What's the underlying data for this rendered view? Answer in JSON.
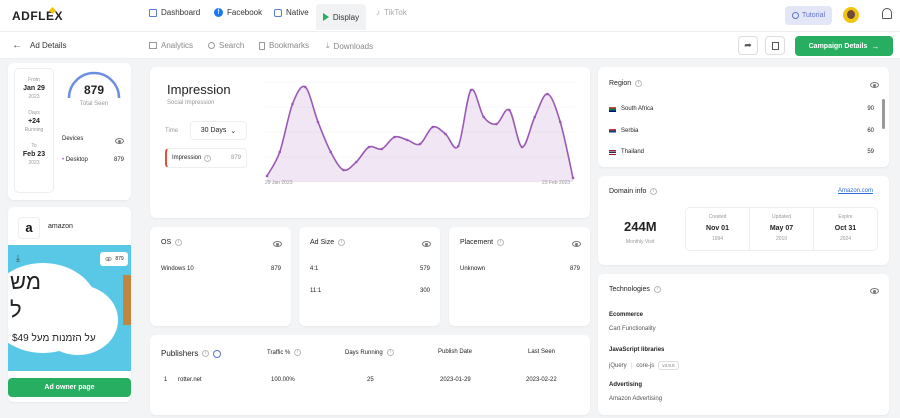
{
  "brand": {
    "logo": "ADFLEX"
  },
  "topnav": {
    "tabs": [
      {
        "label": "Dashboard",
        "icon": "grid-icon"
      },
      {
        "label": "Facebook",
        "icon": "facebook-icon"
      },
      {
        "label": "Native",
        "icon": "native-icon"
      },
      {
        "label": "Display",
        "icon": "play-icon",
        "active": true
      },
      {
        "label": "TikTok",
        "icon": "tiktok-icon"
      }
    ],
    "tutorial_label": "Tutorial"
  },
  "subnav": {
    "items": [
      "Analytics",
      "Search",
      "Bookmarks",
      "Downloads"
    ],
    "campaign_button": "Campaign Details"
  },
  "sidebar": {
    "back_label": "Ad Details",
    "from_label": "From",
    "from_date": "Jan 29",
    "from_year": "2023",
    "days_label": "Days",
    "days_value": "+24",
    "days_status": "Running",
    "to_label": "To",
    "to_date": "Feb 23",
    "to_year": "2023",
    "total_seen": "879",
    "total_seen_label": "Total Seen",
    "devices_label": "Devices",
    "device_name": "Desktop",
    "device_value": "879",
    "advertiser": "amazon",
    "ad_badge": "879",
    "ad_text_line1": "מש",
    "ad_text_line2": "ל",
    "ad_text_line3": "על הזמנות מעל $49",
    "owner_button": "Ad owner page"
  },
  "impression": {
    "title": "Impression",
    "subtitle": "Social Impression",
    "time_label": "Time",
    "range_select": "30 Days",
    "legend_label": "Impression",
    "legend_value": "879",
    "x_start": "29 Jan 2023",
    "x_end": "23 Feb 2023"
  },
  "chart_data": {
    "type": "area",
    "title": "Impression",
    "x": [
      "29 Jan 2023",
      "",
      "",
      "",
      "",
      "",
      "",
      "",
      "",
      "",
      "",
      "",
      "",
      "",
      "",
      "",
      "",
      "",
      "",
      "",
      "",
      "",
      "",
      "",
      "23 Feb 2023"
    ],
    "series": [
      {
        "name": "Impression",
        "values": [
          6,
          30,
          78,
          95,
          60,
          30,
          12,
          20,
          35,
          33,
          45,
          42,
          38,
          55,
          48,
          36,
          92,
          65,
          58,
          72,
          35,
          65,
          88,
          60,
          4
        ]
      }
    ],
    "ylim": [
      0,
      100
    ],
    "color": "#9b59b6"
  },
  "os": {
    "title": "OS",
    "rows": [
      {
        "label": "Windows 10",
        "value": "879"
      }
    ]
  },
  "adsize": {
    "title": "Ad Size",
    "rows": [
      {
        "label": "4:1",
        "value": "579"
      },
      {
        "label": "11:1",
        "value": "300"
      }
    ]
  },
  "placement": {
    "title": "Placement",
    "rows": [
      {
        "label": "Unknown",
        "value": "879"
      }
    ]
  },
  "publishers": {
    "title": "Publishers",
    "headers": [
      "Traffic %",
      "Days Running",
      "Publish Date",
      "Last Seen"
    ],
    "rows": [
      {
        "num": "1",
        "site": "rotter.net",
        "traffic": "100.00%",
        "days": "25",
        "publish": "2023-01-29",
        "last": "2023-02-22"
      }
    ]
  },
  "region": {
    "title": "Region",
    "rows": [
      {
        "name": "South Africa",
        "value": "90"
      },
      {
        "name": "Serbia",
        "value": "60"
      },
      {
        "name": "Thailand",
        "value": "59"
      }
    ]
  },
  "domain": {
    "title": "Domain info",
    "link": "Amazon.com",
    "visits": "244M",
    "visits_label": "Monthly Visit",
    "created_label": "Created",
    "created_date": "Nov 01",
    "created_year": "1994",
    "updated_label": "Updated",
    "updated_date": "May 07",
    "updated_year": "2019",
    "expire_label": "Expire",
    "expire_date": "Oct 31",
    "expire_year": "2024"
  },
  "tech": {
    "title": "Technologies",
    "ecommerce_label": "Ecommerce",
    "ecommerce_item": "Cart Functionality",
    "js_label": "JavaScript libraries",
    "js_item1": "jQuery",
    "js_item2": "core-js",
    "js_version": "v3.9.0",
    "ads_label": "Advertising",
    "ads_item": "Amazon Advertising"
  },
  "colors": {
    "accent": "#27ae60",
    "chart": "#9b59b6",
    "tutorial_bg": "#e3e6f7"
  }
}
